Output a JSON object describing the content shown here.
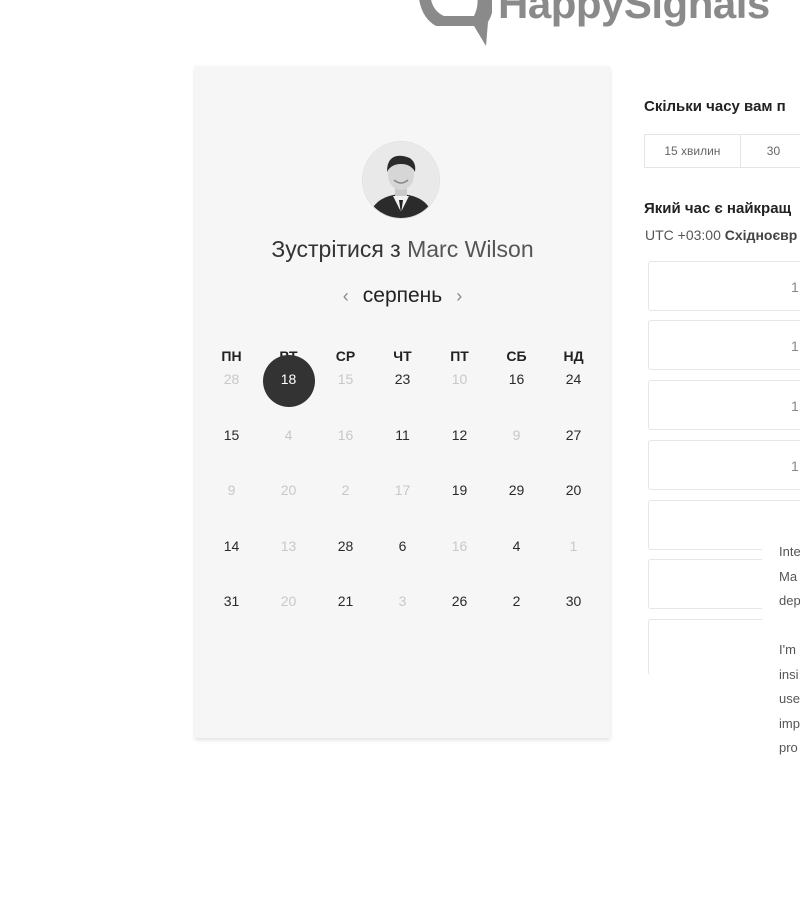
{
  "brand": {
    "name": "HappySignals"
  },
  "profile": {
    "meet_prefix": "Зустрітися з ",
    "host_name": "Marc Wilson"
  },
  "calendar": {
    "month": "серпень",
    "prev_arrow": "‹",
    "next_arrow": "›",
    "weekdays": [
      "ПН",
      "ВТ",
      "СР",
      "ЧТ",
      "ПТ",
      "СБ",
      "НД"
    ],
    "weeks": [
      [
        {
          "d": "28",
          "dim": true
        },
        {
          "d": "18",
          "sel": true
        },
        {
          "d": "15",
          "dim": true
        },
        {
          "d": "23"
        },
        {
          "d": "10",
          "dim": true
        },
        {
          "d": "16"
        },
        {
          "d": "24"
        }
      ],
      [
        {
          "d": "15"
        },
        {
          "d": "4",
          "dim": true
        },
        {
          "d": "16",
          "dim": true
        },
        {
          "d": "11"
        },
        {
          "d": "12"
        },
        {
          "d": "9",
          "dim": true
        },
        {
          "d": "27"
        }
      ],
      [
        {
          "d": "9",
          "dim": true
        },
        {
          "d": "20",
          "dim": true
        },
        {
          "d": "2",
          "dim": true
        },
        {
          "d": "17",
          "dim": true
        },
        {
          "d": "19"
        },
        {
          "d": "29"
        },
        {
          "d": "20"
        }
      ],
      [
        {
          "d": "14"
        },
        {
          "d": "13",
          "dim": true
        },
        {
          "d": "28"
        },
        {
          "d": "6"
        },
        {
          "d": "16",
          "dim": true
        },
        {
          "d": "4"
        },
        {
          "d": "1",
          "dim": true
        }
      ],
      [
        {
          "d": "31"
        },
        {
          "d": "20",
          "dim": true
        },
        {
          "d": "21"
        },
        {
          "d": "3",
          "dim": true
        },
        {
          "d": "26"
        },
        {
          "d": "2"
        },
        {
          "d": "30"
        }
      ]
    ]
  },
  "booking": {
    "duration_question": "Скільки часу вам п",
    "durations": [
      "15 хвилин",
      "30"
    ],
    "time_question": "Який час є найкращ",
    "timezone_offset": "UTC +03:00",
    "timezone_name": "Східноєвр",
    "slots": [
      "1",
      "1",
      "1",
      "1",
      "",
      "",
      ""
    ]
  },
  "popup_lines": [
    "Inte",
    "Ma",
    "dep",
    "",
    "I'm",
    "insi",
    "use",
    "imp",
    "pro"
  ],
  "colors": {
    "selected_day": "#333333",
    "card_bg": "#f6f6f6",
    "dim_day": "#c8c8c8"
  }
}
